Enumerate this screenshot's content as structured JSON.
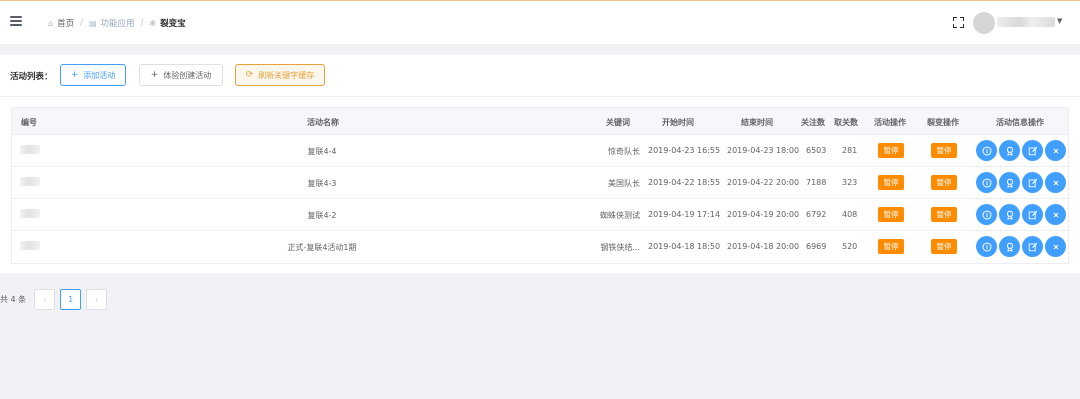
{
  "breadcrumb": {
    "items": [
      {
        "label": "首页",
        "icon": "home-icon"
      },
      {
        "label": "功能应用",
        "icon": "grid-icon"
      },
      {
        "label": "裂变宝",
        "icon": "gear-icon"
      }
    ]
  },
  "header": {
    "username_blurred": true,
    "icons": [
      "menu-icon",
      "fullscreen-icon",
      "avatar",
      "chevron-down-icon"
    ]
  },
  "toolbar": {
    "label": "活动列表：",
    "add_label": "添加活动",
    "trial_label": "体验创建活动",
    "refresh_label": "刷新关键字缓存"
  },
  "table": {
    "headers": {
      "id": "编号",
      "name": "活动名称",
      "keyword": "关键词",
      "start": "开始时间",
      "end": "结束时间",
      "follow": "关注数",
      "unfollow": "取关数",
      "activity_op": "活动操作",
      "fission_op": "裂变操作",
      "info_op": "活动信息操作"
    },
    "rows": [
      {
        "name": "复联4-4",
        "keyword": "惊奇队长",
        "start": "2019-04-23 16:55",
        "end": "2019-04-23 18:00",
        "follow": "6503",
        "unfollow": "281",
        "activity_btn": "暂停",
        "fission_btn": "暂停"
      },
      {
        "name": "复联4-3",
        "keyword": "美国队长",
        "start": "2019-04-22 18:55",
        "end": "2019-04-22 20:00",
        "follow": "7188",
        "unfollow": "323",
        "activity_btn": "暂停",
        "fission_btn": "暂停"
      },
      {
        "name": "复联4-2",
        "keyword": "蜘蛛侠测试",
        "start": "2019-04-19 17:14",
        "end": "2019-04-19 20:00",
        "follow": "6792",
        "unfollow": "408",
        "activity_btn": "暂停",
        "fission_btn": "暂停"
      },
      {
        "name": "正式-复联4活动1期",
        "keyword": "钢铁侠结...",
        "start": "2019-04-18 18:50",
        "end": "2019-04-18 20:00",
        "follow": "6969",
        "unfollow": "520",
        "activity_btn": "暂停",
        "fission_btn": "暂停"
      }
    ],
    "info_icons": [
      "info-icon",
      "award-icon",
      "edit-icon",
      "close-icon"
    ]
  },
  "pagination": {
    "total": "共 4 条",
    "current_page": "1",
    "prev": "‹",
    "next": "›"
  },
  "colors": {
    "primary": "#409eff",
    "warning": "#e6a23c",
    "pause_button": "#ff8c00",
    "topbar_accent": "#f2c48c"
  }
}
